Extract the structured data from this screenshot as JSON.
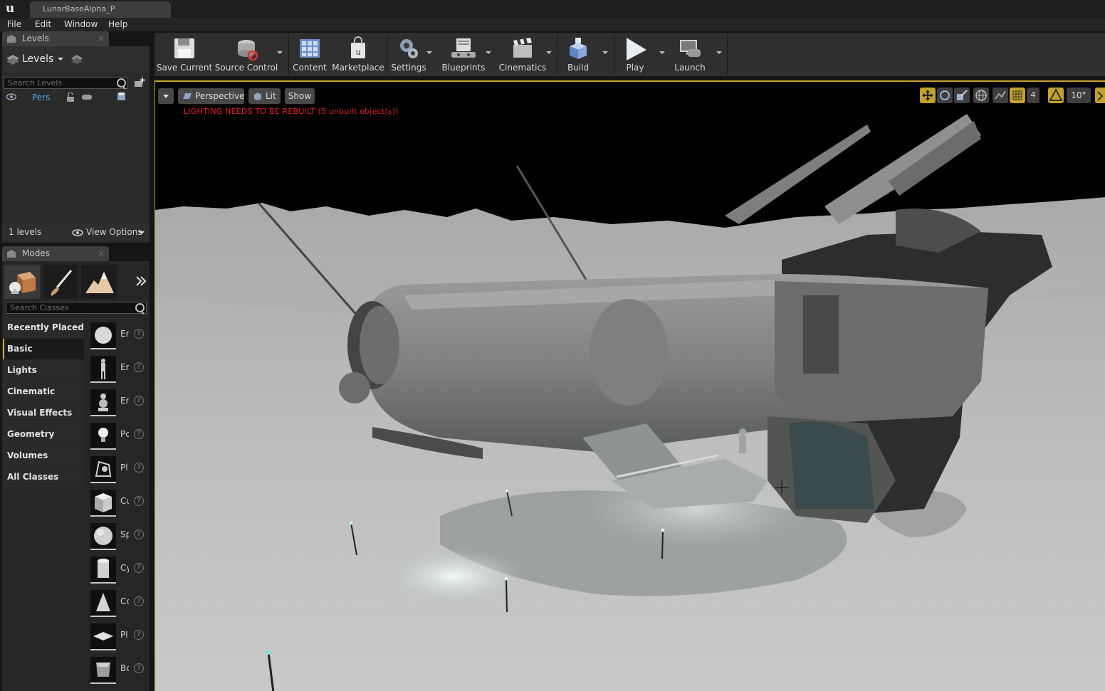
{
  "window": {
    "tab_title": "LunarBaseAlpha_P"
  },
  "menu": [
    "File",
    "Edit",
    "Window",
    "Help"
  ],
  "levels_panel": {
    "tab_label": "Levels",
    "header": "Levels",
    "search_placeholder": "Search Levels",
    "level_item": "Pers",
    "count": "1 levels",
    "view_options": "View Options"
  },
  "modes_panel": {
    "tab_label": "Modes",
    "search_placeholder": "Search Classes",
    "categories": [
      "Recently Placed",
      "Basic",
      "Lights",
      "Cinematic",
      "Visual Effects",
      "Geometry",
      "Volumes",
      "All Classes"
    ],
    "active_category": "Basic",
    "assets": [
      {
        "label": "Er",
        "icon": "sphere-icon"
      },
      {
        "label": "Er",
        "icon": "character-icon"
      },
      {
        "label": "Er",
        "icon": "pawn-icon"
      },
      {
        "label": "Pc",
        "icon": "light-bulb-icon"
      },
      {
        "label": "Pl",
        "icon": "player-start-icon"
      },
      {
        "label": "Cu",
        "icon": "cube-icon"
      },
      {
        "label": "Sp",
        "icon": "sphere-icon"
      },
      {
        "label": "Cy",
        "icon": "cylinder-icon"
      },
      {
        "label": "Cc",
        "icon": "cone-icon"
      },
      {
        "label": "Pl",
        "icon": "plane-icon"
      },
      {
        "label": "Bc",
        "icon": "box-trigger-icon"
      }
    ]
  },
  "toolbar": {
    "save_current": "Save Current",
    "source_control": "Source Control",
    "content": "Content",
    "marketplace": "Marketplace",
    "settings": "Settings",
    "blueprints": "Blueprints",
    "cinematics": "Cinematics",
    "build": "Build",
    "play": "Play",
    "launch": "Launch"
  },
  "viewport": {
    "perspective": "Perspective",
    "lit": "Lit",
    "show": "Show",
    "warning": "LIGHTING NEEDS TO BE REBUILT (5 unbuilt object(s))",
    "angle_snap": "10°",
    "scale_snap": "4"
  },
  "colors": {
    "accent": "#c4a12c",
    "warning": "#e02323",
    "ground": "#bcbcbc",
    "sky": "#000000"
  }
}
